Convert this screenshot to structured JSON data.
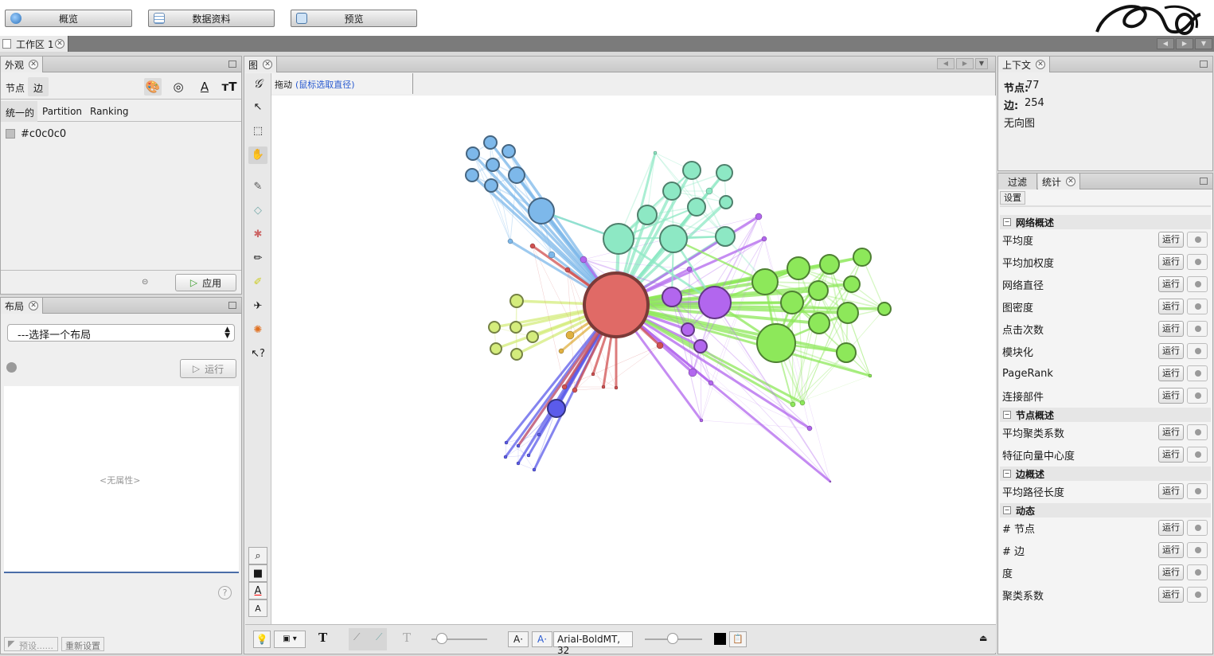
{
  "top_buttons": [
    "概览",
    "数据资料",
    "预览"
  ],
  "workspace_tab": "工作区 1",
  "appearance": {
    "title": "外观",
    "tabs": [
      "节点",
      "边"
    ],
    "sub_tabs": [
      "统一的",
      "Partition",
      "Ranking"
    ],
    "color_value": "#c0c0c0",
    "apply_label": "应用"
  },
  "layout_panel": {
    "title": "布局",
    "select_value": "---选择一个布局",
    "run_label": "运行",
    "no_property": "<无属性>",
    "presets_label": "预设......",
    "reset_label": "重新设置"
  },
  "graph": {
    "title": "图",
    "drag_label": "拖动",
    "drag_hint": "(鼠标选取直径)",
    "font_label": "Arial-BoldMT, 32"
  },
  "context": {
    "title": "上下文",
    "nodes_label": "节点:",
    "nodes_value": "77",
    "edges_label": "边:",
    "edges_value": "254",
    "graph_type": "无向图"
  },
  "stats": {
    "tabs": [
      "过滤",
      "统计"
    ],
    "settings_label": "设置",
    "run_label": "运行",
    "sections": [
      {
        "title": "网络概述",
        "items": [
          "平均度",
          "平均加权度",
          "网络直径",
          "图密度",
          "点击次数",
          "模块化",
          "PageRank",
          "连接部件"
        ]
      },
      {
        "title": "节点概述",
        "items": [
          "平均聚类系数",
          "特征向量中心度"
        ]
      },
      {
        "title": "边概述",
        "items": [
          "平均路径长度"
        ]
      },
      {
        "title": "动态",
        "items": [
          "# 节点",
          "# 边",
          "度",
          "聚类系数"
        ]
      }
    ]
  },
  "colors": {
    "hub": "#e06a66",
    "blue": "#7db8ea",
    "teal": "#8de8c4",
    "purple": "#b266ee",
    "green": "#8de85a",
    "yellow": "#d4ec7c",
    "indigo": "#5b5bea"
  }
}
